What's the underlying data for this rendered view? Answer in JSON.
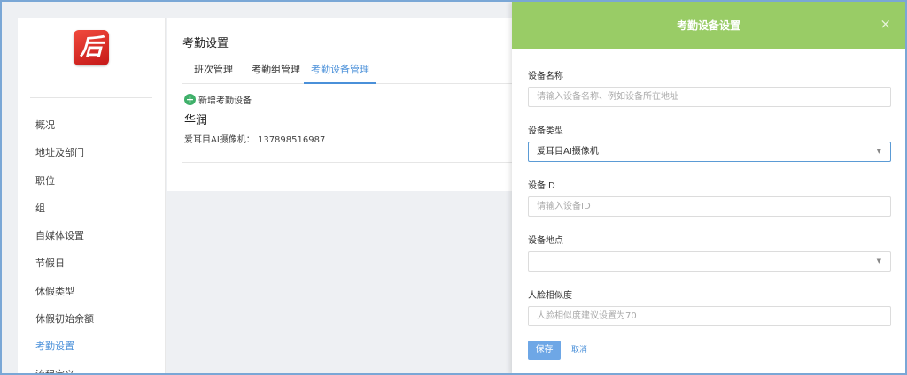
{
  "sidebar": {
    "logo_glyph": "后",
    "items": [
      {
        "label": "概况"
      },
      {
        "label": "地址及部门"
      },
      {
        "label": "职位"
      },
      {
        "label": "组"
      },
      {
        "label": "自媒体设置"
      },
      {
        "label": "节假日"
      },
      {
        "label": "休假类型"
      },
      {
        "label": "休假初始余额"
      },
      {
        "label": "考勤设置",
        "active": true
      },
      {
        "label": "流程定义"
      }
    ]
  },
  "main": {
    "title": "考勤设置",
    "tabs": [
      {
        "label": "班次管理"
      },
      {
        "label": "考勤组管理"
      },
      {
        "label": "考勤设备管理",
        "active": true
      }
    ],
    "add_label": "新增考勤设备",
    "device_group": "华润",
    "device_info": "爱耳目AI摄像机： 137898516987"
  },
  "dialog": {
    "title": "考勤设备设置",
    "close_glyph": "×",
    "fields": {
      "name": {
        "label": "设备名称",
        "placeholder": "请输入设备名称、例如设备所在地址"
      },
      "type": {
        "label": "设备类型",
        "value": "爱耳目AI摄像机"
      },
      "id": {
        "label": "设备ID",
        "placeholder": "请输入设备ID"
      },
      "location": {
        "label": "设备地点",
        "value": ""
      },
      "similarity": {
        "label": "人脸相似度",
        "placeholder": "人脸相似度建议设置为70"
      }
    },
    "save_label": "保存",
    "cancel_label": "取消"
  },
  "colors": {
    "header_green": "#99cc66",
    "accent_blue": "#4a90d9",
    "add_green": "#3fb06a"
  },
  "icons": [
    "app-logo-icon",
    "plus-circle-icon",
    "close-icon",
    "dropdown-caret-icon"
  ]
}
